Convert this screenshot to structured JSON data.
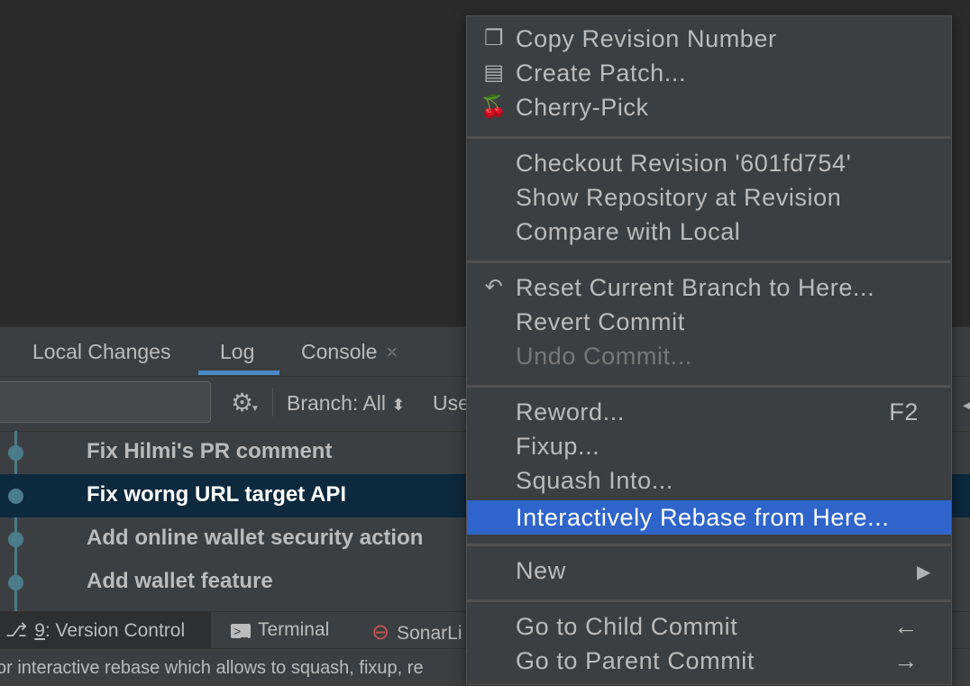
{
  "tabs": [
    {
      "label": "Local Changes"
    },
    {
      "label": "Log"
    },
    {
      "label": "Console",
      "close": "×"
    }
  ],
  "toolbar": {
    "branch_label": "Branch: All",
    "branch_caret": "⬍",
    "user_label": "Use"
  },
  "commits": [
    {
      "message": "Fix Hilmi's PR comment"
    },
    {
      "message": "Fix worng URL target API"
    },
    {
      "message": "Add online wallet security action"
    },
    {
      "message": "Add wallet feature"
    }
  ],
  "bottom_tabs": {
    "version_control_num": "9",
    "version_control_rest": ": Version Control",
    "terminal": "Terminal",
    "sonar": "SonarLi"
  },
  "status_text": "or interactive rebase which allows to squash, fixup, re",
  "context_menu": {
    "items": [
      {
        "label": "Copy Revision Number",
        "icon": "copy-icon"
      },
      {
        "label": "Create Patch...",
        "icon": "patch-icon"
      },
      {
        "label": "Cherry-Pick",
        "icon": "cherry-icon"
      },
      {
        "label": "Checkout Revision '601fd754'"
      },
      {
        "label": "Show Repository at Revision"
      },
      {
        "label": "Compare with Local"
      },
      {
        "label": "Reset Current Branch to Here...",
        "icon": "undo-icon"
      },
      {
        "label": "Revert Commit"
      },
      {
        "label": "Undo Commit...",
        "disabled": true
      },
      {
        "label": "Reword...",
        "shortcut": "F2"
      },
      {
        "label": "Fixup..."
      },
      {
        "label": "Squash Into..."
      },
      {
        "label": "Interactively Rebase from Here...",
        "highlighted": true
      },
      {
        "label": "New",
        "submenu": "▶"
      },
      {
        "label": "Go to Child Commit",
        "shortcut": "←"
      },
      {
        "label": "Go to Parent Commit",
        "shortcut": "→"
      }
    ]
  },
  "colors": {
    "highlight": "#2f65ca",
    "selected_row": "#0d293e",
    "graph": "#4a7c8c",
    "tab_underline": "#4a88c7"
  }
}
